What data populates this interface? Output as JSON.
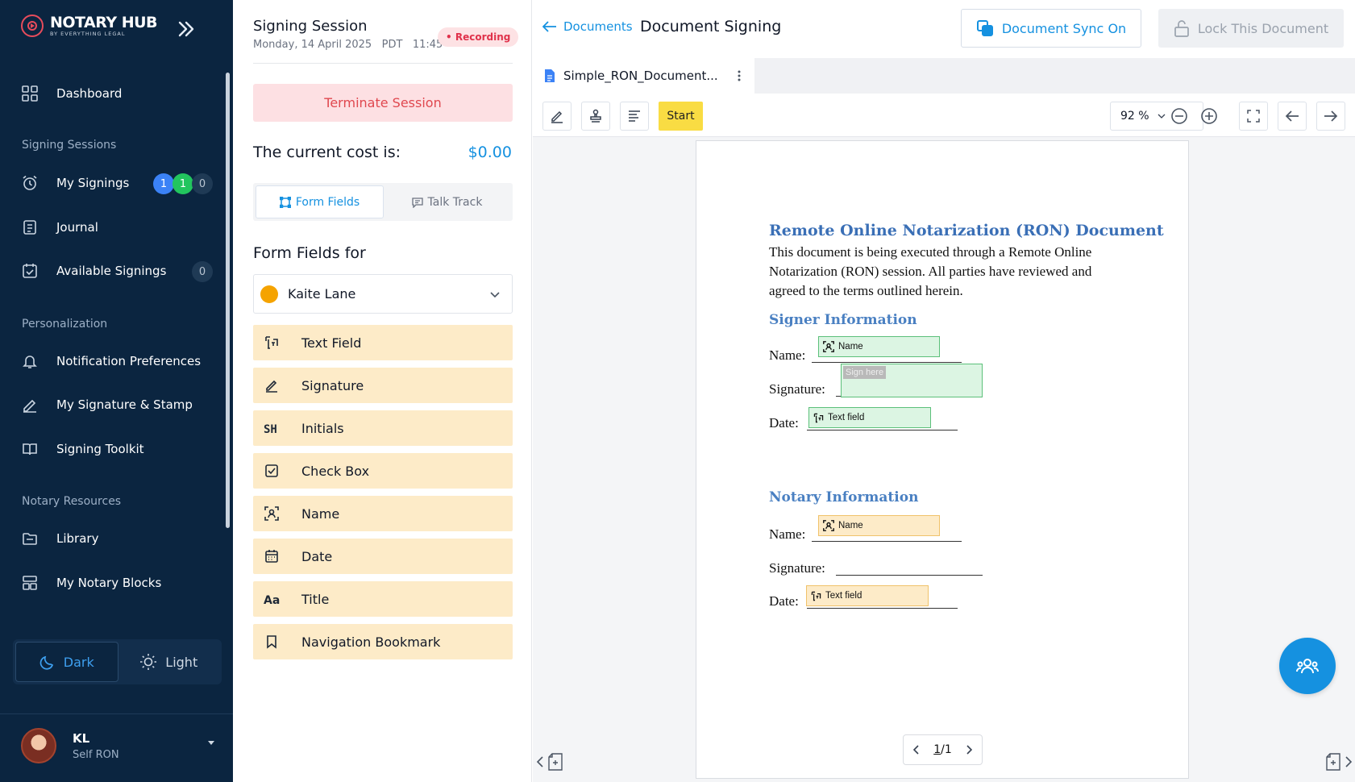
{
  "brand": {
    "name": "NOTARY HUB",
    "tagline": "BY EVERYTHING LEGAL"
  },
  "sidebar": {
    "dashboard": "Dashboard",
    "sections": {
      "signing": "Signing Sessions",
      "personalization": "Personalization",
      "resources": "Notary Resources"
    },
    "items": {
      "my_signings": {
        "label": "My Signings",
        "badges": [
          "1",
          "1",
          "0"
        ]
      },
      "journal": "Journal",
      "available": {
        "label": "Available Signings",
        "badge": "0"
      },
      "notifications": "Notification Preferences",
      "signature_stamp": "My Signature & Stamp",
      "toolkit": "Signing Toolkit",
      "library": "Library",
      "notary_blocks": "My Notary Blocks"
    },
    "theme": {
      "dark": "Dark",
      "light": "Light",
      "active": "Dark"
    },
    "user": {
      "initials": "KL",
      "role": "Self RON"
    }
  },
  "session": {
    "title": "Signing Session",
    "date": "Monday, 14 April 2025",
    "tz": "PDT",
    "time": "11:45",
    "recording": "• Recording",
    "terminate": "Terminate Session",
    "cost_label": "The current cost is:",
    "cost_value": "$0.00",
    "tabs": {
      "form_fields": "Form Fields",
      "talk_track": "Talk Track"
    },
    "form_fields_for": "Form Fields for",
    "signer": "Kaite Lane",
    "fields": [
      "Text Field",
      "Signature",
      "Initials",
      "Check Box",
      "Name",
      "Date",
      "Title",
      "Navigation Bookmark"
    ]
  },
  "doc": {
    "back": "Documents",
    "title": "Document Signing",
    "sync": "Document Sync On",
    "lock": "Lock This Document",
    "file_tab": "Simple_RON_Document...",
    "start": "Start",
    "zoom": "92 %",
    "page": {
      "heading": "Remote Online Notarization (RON) Document",
      "body": "This document is being executed through a Remote Online Notarization (RON) session. All parties have reviewed and agreed to the terms outlined herein.",
      "signer_heading": "Signer Information",
      "notary_heading": "Notary Information",
      "name_label": "Name:",
      "signature_label": "Signature:",
      "date_label": "Date:",
      "name_field": "Name",
      "sign_here": "Sign here",
      "text_field": "Text field"
    },
    "pager": {
      "current": "1",
      "sep": "/",
      "total": "1"
    }
  }
}
